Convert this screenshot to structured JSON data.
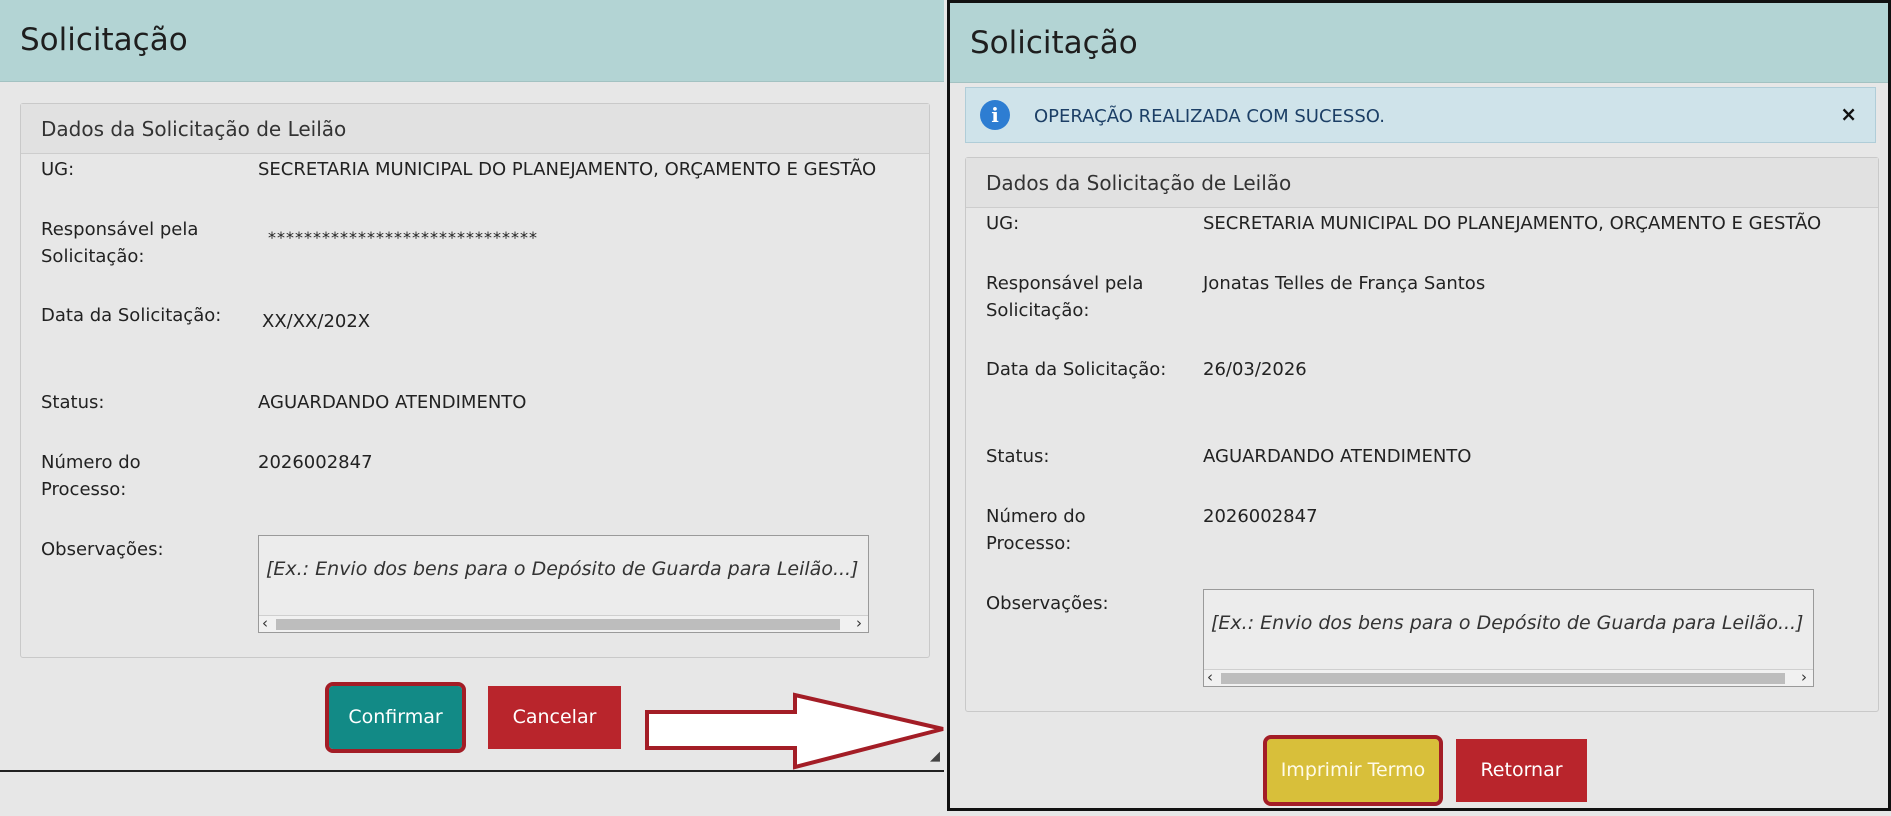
{
  "left_dialog": {
    "title": "Solicitação",
    "panel_title": "Dados da Solicitação de Leilão",
    "fields": {
      "ug_label": "UG:",
      "ug_value": "SECRETARIA MUNICIPAL DO PLANEJAMENTO, ORÇAMENTO E GESTÃO",
      "responsavel_label": "Responsável pela Solicitação:",
      "responsavel_value": "******************************",
      "data_label": "Data da Solicitação:",
      "data_value": "XX/XX/202X",
      "status_label": "Status:",
      "status_value": "AGUARDANDO ATENDIMENTO",
      "processo_label": "Número do Processo:",
      "processo_value": "2026002847",
      "observacoes_label": "Observações:",
      "observacoes_placeholder": "[Ex.: Envio dos bens para o Depósito de Guarda para Leilão...]"
    },
    "buttons": {
      "confirm": "Confirmar",
      "cancel": "Cancelar"
    }
  },
  "right_dialog": {
    "title": "Solicitação",
    "alert": {
      "message": "OPERAÇÃO REALIZADA COM SUCESSO.",
      "icon": "info-icon",
      "close": "×"
    },
    "panel_title": "Dados da Solicitação de Leilão",
    "fields": {
      "ug_label": "UG:",
      "ug_value": "SECRETARIA MUNICIPAL DO PLANEJAMENTO, ORÇAMENTO E GESTÃO",
      "responsavel_label": "Responsável pela Solicitação:",
      "responsavel_value": "Jonatas Telles de França Santos",
      "data_label": "Data da Solicitação:",
      "data_value": "26/03/2026",
      "status_label": "Status:",
      "status_value": "AGUARDANDO ATENDIMENTO",
      "processo_label": "Número do Processo:",
      "processo_value": "2026002847",
      "observacoes_label": "Observações:",
      "observacoes_placeholder": "[Ex.: Envio dos bens para o Depósito de Guarda para Leilão...]"
    },
    "buttons": {
      "print": "Imprimir Termo",
      "back": "Retornar"
    }
  },
  "colors": {
    "titlebar": "#b3d4d4",
    "confirm_button": "#128a86",
    "cancel_button": "#b9252c",
    "print_button": "#d8bf3a",
    "highlight": "#a31d26",
    "alert_background": "#cfe3ea"
  }
}
